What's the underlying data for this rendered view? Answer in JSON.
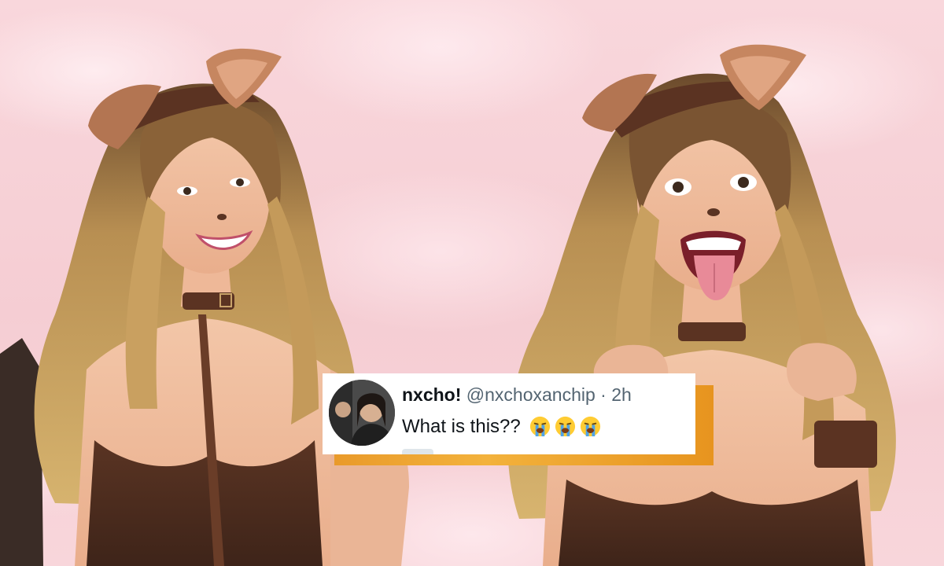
{
  "scene": {
    "background_color": "#f7d3d8",
    "photo_left": {
      "subject": "woman-in-puppy-costume-smiling"
    },
    "photo_right": {
      "subject": "woman-in-puppy-costume-tongue-out"
    }
  },
  "tweet": {
    "display_name": "nxcho!",
    "handle": "@nxchoxanchip",
    "separator": "·",
    "time": "2h",
    "text": "What is this??",
    "emojis": [
      "loudly-crying-face-icon",
      "loudly-crying-face-icon",
      "loudly-crying-face-icon"
    ],
    "accent_color": "#f0a634"
  }
}
